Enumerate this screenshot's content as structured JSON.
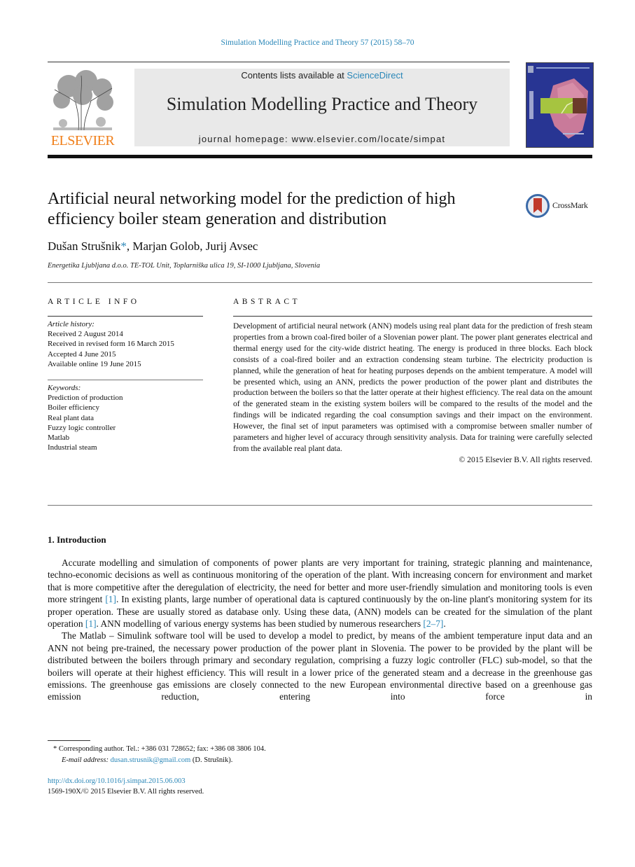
{
  "running_head": "Simulation Modelling Practice and Theory 57 (2015) 58–70",
  "masthead": {
    "publisher_logo_text": "ELSEVIER",
    "contents_prefix": "Contents lists available at ",
    "contents_link": "ScienceDirect",
    "journal_title": "Simulation Modelling Practice and Theory",
    "homepage": "journal homepage: www.elsevier.com/locate/simpat"
  },
  "article": {
    "title": "Artificial neural networking model for the prediction of high efficiency boiler steam generation and distribution",
    "crossmark_label": "CrossMark",
    "authors": [
      {
        "name": "Dušan Strušnik",
        "corresponding_mark": "*"
      },
      {
        "name": "Marjan Golob"
      },
      {
        "name": "Jurij Avsec"
      }
    ],
    "author_sep": ", ",
    "affiliation": "Energetika Ljubljana d.o.o. TE-TOL Unit, Toplarniška ulica 19, SI-1000 Ljubljana, Slovenia"
  },
  "article_info": {
    "heading": "ARTICLE INFO",
    "history_label": "Article history:",
    "history": [
      "Received 2 August 2014",
      "Received in revised form 16 March 2015",
      "Accepted 4 June 2015",
      "Available online 19 June 2015"
    ],
    "keywords_label": "Keywords:",
    "keywords": [
      "Prediction of production",
      "Boiler efficiency",
      "Real plant data",
      "Fuzzy logic controller",
      "Matlab",
      "Industrial steam"
    ]
  },
  "abstract": {
    "heading": "ABSTRACT",
    "text": "Development of artificial neural network (ANN) models using real plant data for the prediction of fresh steam properties from a brown coal-fired boiler of a Slovenian power plant. The power plant generates electrical and thermal energy used for the city-wide district heating. The energy is produced in three blocks. Each block consists of a coal-fired boiler and an extraction condensing steam turbine. The electricity production is planned, while the generation of heat for heating purposes depends on the ambient temperature. A model will be presented which, using an ANN, predicts the power production of the power plant and distributes the production between the boilers so that the latter operate at their highest efficiency. The real data on the amount of the generated steam in the existing system boilers will be compared to the results of the model and the findings will be indicated regarding the coal consumption savings and their impact on the environment. However, the final set of input parameters was optimised with a compromise between smaller number of parameters and higher level of accuracy through sensitivity analysis. Data for training were carefully selected from the available real plant data.",
    "copyright": "© 2015 Elsevier B.V. All rights reserved."
  },
  "introduction": {
    "heading": "1. Introduction",
    "p1": {
      "a": "Accurate modelling and simulation of components of power plants are very important for training, strategic planning and maintenance, techno-economic decisions as well as continuous monitoring of the operation of the plant. With increasing concern for environment and market that is more competitive after the deregulation of electricity, the need for better and more user-friendly simulation and monitoring tools is even more stringent ",
      "ref1": "[1]",
      "b": ". In existing plants, large number of operational data is captured continuously by the on-line plant's monitoring system for its proper operation. These are usually stored as database only. Using these data, (ANN) models can be created for the simulation of the plant operation ",
      "ref2": "[1]",
      "c": ". ANN modelling of various energy systems has been studied by numerous researchers ",
      "ref3": "[2–7]",
      "d": "."
    },
    "p2": "The Matlab – Simulink software tool will be used to develop a model to predict, by means of the ambient temperature input data and an ANN not being pre-trained, the necessary power production of the power plant in Slovenia. The power to be provided by the plant will be distributed between the boilers through primary and secondary regulation, comprising a fuzzy logic controller (FLC) sub-model, so that the boilers will operate at their highest efficiency. This will result in a lower price of the generated steam and a decrease in the greenhouse gas emissions. The greenhouse gas emissions are closely connected to the new European environmental directive based on a greenhouse gas emission reduction, entering into force in"
  },
  "footnotes": {
    "corresponding": "* Corresponding author. Tel.: +386 031 728652; fax: +386 08 3806 104.",
    "email_label": "E-mail address: ",
    "email": "dusan.strusnik@gmail.com",
    "email_suffix": " (D. Strušnik).",
    "doi": "http://dx.doi.org/10.1016/j.simpat.2015.06.003",
    "issn_copyright": "1569-190X/© 2015 Elsevier B.V. All rights reserved."
  },
  "colors": {
    "link": "#2a87b8",
    "elsevier_orange": "#f07f1a",
    "masthead_gray": "#e9e9e9",
    "cover_blue": "#283593"
  }
}
